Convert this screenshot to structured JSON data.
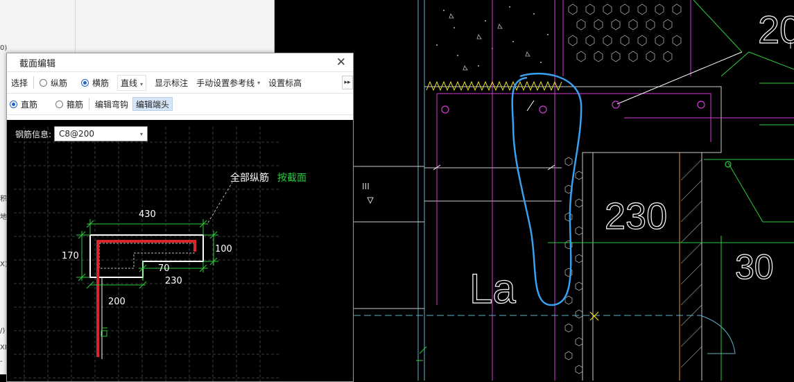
{
  "dialog": {
    "title": "截面编辑",
    "close_glyph": "✕"
  },
  "toolbar": {
    "select_label": "选择",
    "longitudinal_label": "纵筋",
    "transverse_label": "横筋",
    "line_mode": "直线",
    "show_dims_label": "显示标注",
    "manual_ref_label": "手动设置参考线",
    "set_elevation_label": "设置标高",
    "more_glyph": "▸▸"
  },
  "toolbar2": {
    "straight_label": "直筋",
    "stirrup_label": "箍筋",
    "edit_hook_label": "编辑弯钩",
    "edit_end_label": "编辑端头"
  },
  "rebar_info": {
    "label": "钢筋信息:",
    "value": "C8@200"
  },
  "section": {
    "annotation_white": "全部纵筋",
    "annotation_green": "按截面",
    "dim_top": "430",
    "dim_right": "100",
    "dim_left": "170",
    "dim_step": "70",
    "dim_bottom": "230",
    "dim_leg": "200"
  },
  "cad": {
    "label_top": "20",
    "label_230": "230",
    "label_30": "30",
    "label_la": "La",
    "label_roman": "III"
  },
  "edge_glyphs": [
    "0)",
    "积",
    "地",
    "X)",
    "/)",
    "XH",
    "-"
  ],
  "colors": {
    "rebar": "#d9262b",
    "dim": "#2ecc40",
    "magenta": "#d63cd6",
    "cyan": "#5fb2c8",
    "highlight": "#3aa0f0",
    "yellow": "#f0e020"
  }
}
